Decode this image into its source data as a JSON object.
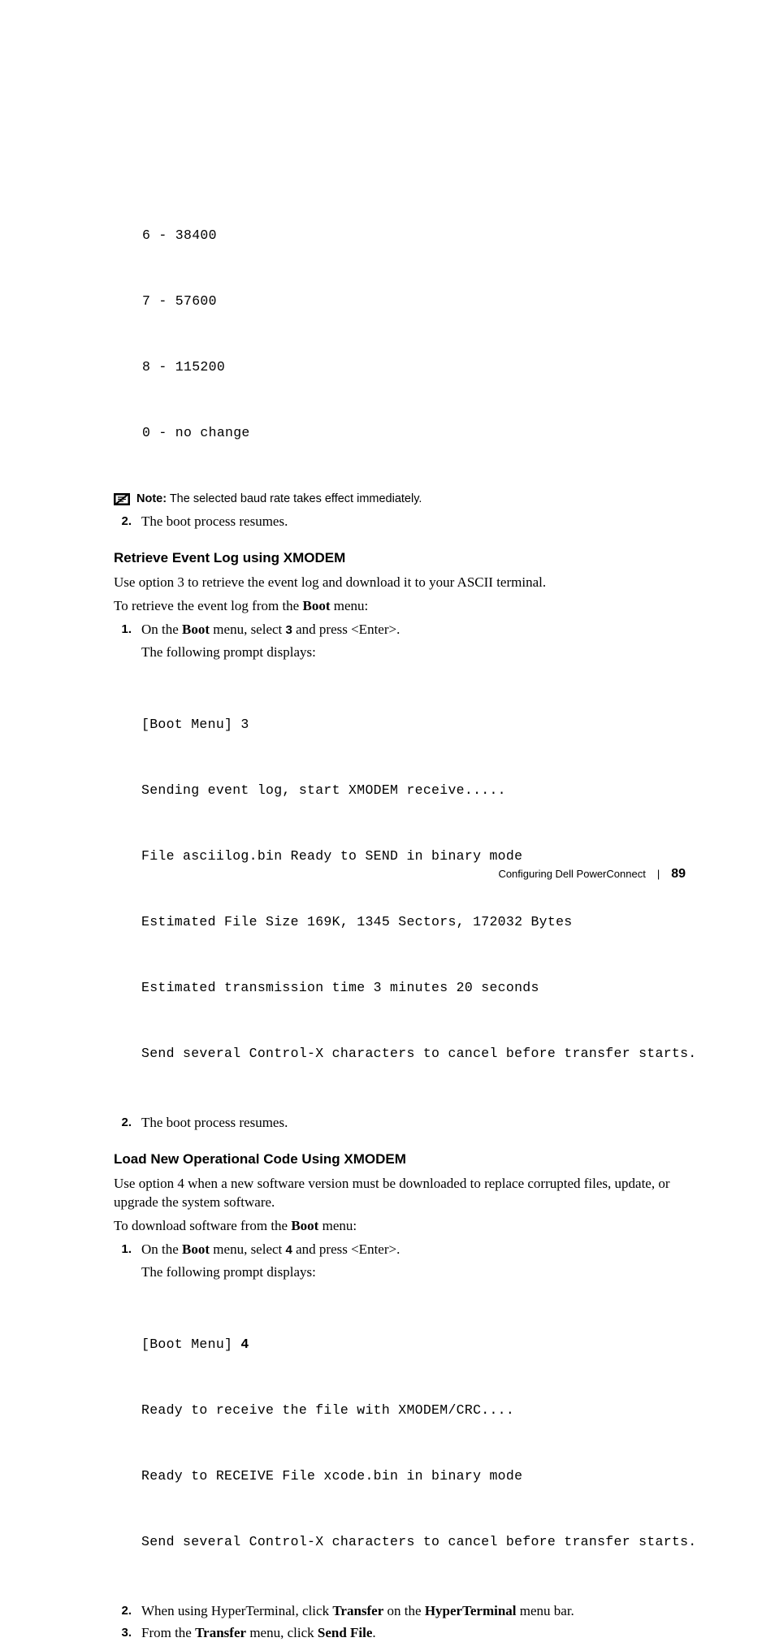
{
  "baud": {
    "l1": "6 - 38400",
    "l2": "7 - 57600",
    "l3": "8 - 115200",
    "l4": "0 - no change"
  },
  "note": {
    "label": "Note:",
    "text": " The selected baud rate takes effect immediately."
  },
  "resume_num": "2.",
  "resume_text": "The boot process resumes.",
  "sec1": {
    "heading": "Retrieve Event Log using XMODEM",
    "p1": "Use option 3 to retrieve the event log and download it to your ASCII terminal.",
    "p2a": "To retrieve the event log from the ",
    "p2b": "Boot",
    "p2c": " menu:",
    "step1num": "1.",
    "step1a": "On the ",
    "step1b": "Boot",
    "step1c": " menu, select ",
    "step1d": "3",
    "step1e": " and press <Enter>.",
    "step1p2": "The following prompt displays:",
    "code": {
      "l1": "[Boot Menu] 3",
      "l2": "Sending event log, start XMODEM receive.....",
      "l3": "File asciilog.bin Ready to SEND in binary mode",
      "l4": "Estimated File Size 169K, 1345 Sectors, 172032 Bytes",
      "l5": "Estimated transmission time 3 minutes 20 seconds",
      "l6": "Send several Control-X characters to cancel before transfer starts."
    },
    "step2num": "2.",
    "step2": "The boot process resumes."
  },
  "sec2": {
    "heading": "Load New Operational Code Using XMODEM",
    "p1": "Use option 4 when a new software version must be downloaded to replace corrupted files, update, or upgrade the system software.",
    "p2a": "To download software from the ",
    "p2b": "Boot",
    "p2c": " menu:",
    "step1num": "1.",
    "step1a": "On the ",
    "step1b": "Boot",
    "step1c": " menu, select ",
    "step1d": "4",
    "step1e": " and press <Enter>.",
    "step1p2": "The following prompt displays:",
    "code": {
      "l1a": "[Boot Menu] ",
      "l1b": "4",
      "l2": "Ready to receive the file with XMODEM/CRC....",
      "l3": "Ready to RECEIVE File xcode.bin in binary mode",
      "l4": "Send several Control-X characters to cancel before transfer starts."
    },
    "step2num": "2.",
    "step2a": "When using HyperTerminal, click ",
    "step2b": "Transfer",
    "step2c": " on the ",
    "step2d": "HyperTerminal",
    "step2e": " menu bar.",
    "step3num": "3.",
    "step3a": "From the ",
    "step3b": "Transfer",
    "step3c": " menu, click ",
    "step3d": "Send File",
    "step3e": "."
  },
  "footer": {
    "title": "Configuring Dell PowerConnect",
    "page": "89"
  }
}
